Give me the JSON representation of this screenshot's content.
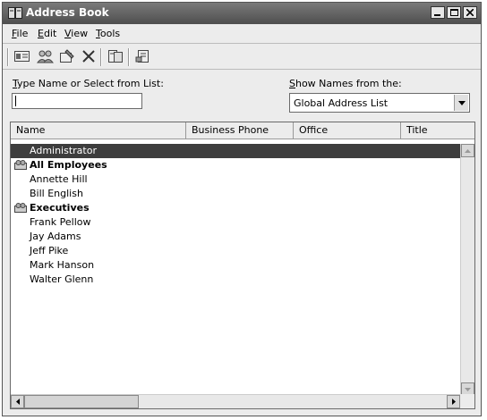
{
  "window": {
    "title": "Address Book"
  },
  "menu": [
    {
      "label": "File",
      "key": "F",
      "rest": "ile"
    },
    {
      "label": "Edit",
      "key": "E",
      "rest": "dit"
    },
    {
      "label": "View",
      "key": "V",
      "rest": "iew"
    },
    {
      "label": "Tools",
      "key": "T",
      "rest": "ools"
    }
  ],
  "toolbar": {
    "icons": [
      "new-entry-icon",
      "new-group-icon",
      "properties-icon",
      "delete-icon",
      "find-icon",
      "add-to-contacts-icon"
    ]
  },
  "search": {
    "label_key": "T",
    "label_rest": "ype Name or Select from List:",
    "value": ""
  },
  "show_names": {
    "label_key": "S",
    "label_rest": "how Names from the:",
    "selected": "Global Address List"
  },
  "columns": [
    "Name",
    "Business Phone",
    "Office",
    "Title"
  ],
  "rows": [
    {
      "name": "Administrator",
      "type": "user",
      "selected": true
    },
    {
      "name": "All Employees",
      "type": "group",
      "selected": false
    },
    {
      "name": "Annette Hill",
      "type": "user",
      "selected": false
    },
    {
      "name": "Bill English",
      "type": "user",
      "selected": false
    },
    {
      "name": "Executives",
      "type": "group",
      "selected": false
    },
    {
      "name": "Frank Pellow",
      "type": "user",
      "selected": false
    },
    {
      "name": "Jay Adams",
      "type": "user",
      "selected": false
    },
    {
      "name": "Jeff Pike",
      "type": "user",
      "selected": false
    },
    {
      "name": "Mark Hanson",
      "type": "user",
      "selected": false
    },
    {
      "name": "Walter Glenn",
      "type": "user",
      "selected": false
    }
  ],
  "colors": {
    "titlebar": "#5a5a5a",
    "selection": "#3d3d3d",
    "chrome": "#ececec"
  }
}
